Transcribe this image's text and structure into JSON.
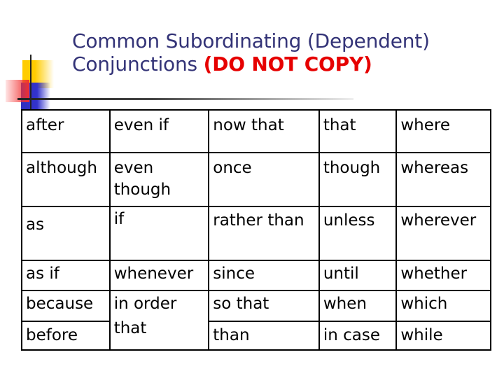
{
  "title": {
    "line1": "Common Subordinating (Dependent)",
    "line2_prefix": "Conjunctions ",
    "warning": "(DO NOT COPY)"
  },
  "colors": {
    "title": "#333377",
    "warning": "#e60000",
    "accent_yellow": "#ffcc00",
    "accent_blue": "#3333cc",
    "accent_red": "#f03030"
  },
  "table": {
    "rows": [
      [
        "after",
        "even if",
        "now that",
        "that",
        "where"
      ],
      [
        "although",
        "even though",
        "once",
        "though",
        "whereas"
      ],
      [
        "as",
        "if",
        "rather than",
        "unless",
        "wherever"
      ],
      [
        "as if",
        "whenever",
        "since",
        "until",
        "whether"
      ],
      [
        "because",
        "in order",
        "so that",
        "when",
        "which"
      ],
      [
        "before",
        "that",
        "than",
        "in case",
        "while"
      ]
    ]
  }
}
